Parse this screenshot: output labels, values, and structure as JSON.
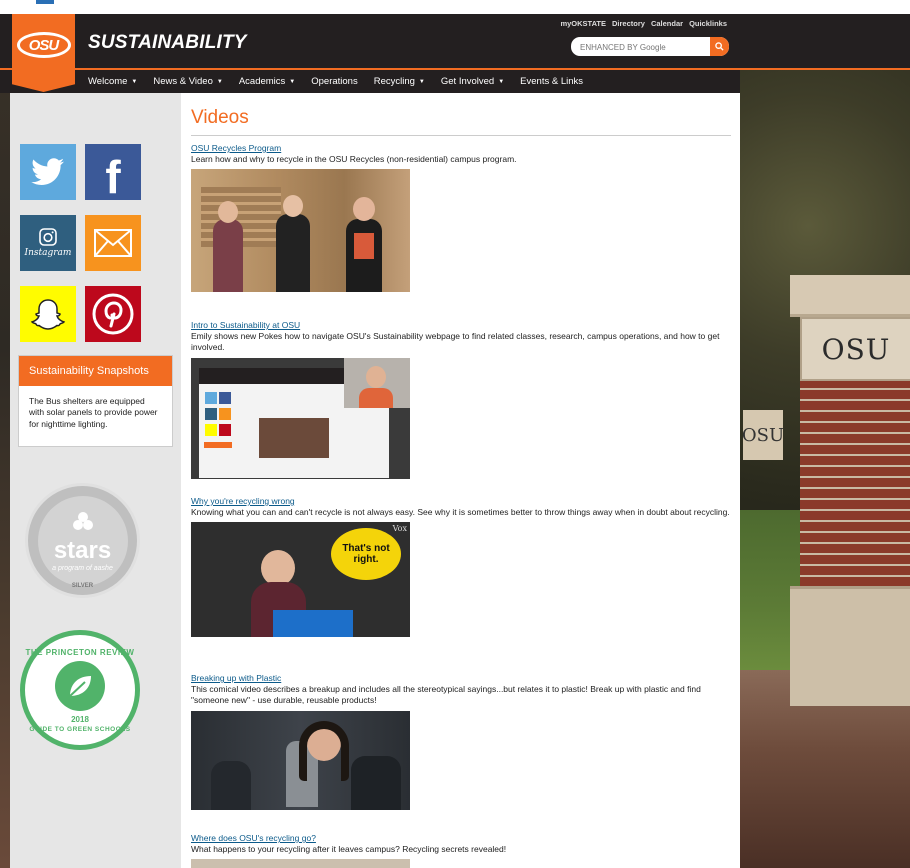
{
  "header": {
    "site_title": "SUSTAINABILITY",
    "logo_text": "OSU",
    "quicklinks": [
      "myOKSTATE",
      "Directory",
      "Calendar",
      "Quicklinks"
    ],
    "search_placeholder": "ENHANCED BY Google"
  },
  "nav": {
    "items": [
      {
        "label": "Welcome",
        "dropdown": true
      },
      {
        "label": "News & Video",
        "dropdown": true
      },
      {
        "label": "Academics",
        "dropdown": true
      },
      {
        "label": "Operations",
        "dropdown": false
      },
      {
        "label": "Recycling",
        "dropdown": true
      },
      {
        "label": "Get Involved",
        "dropdown": true
      },
      {
        "label": "Events & Links",
        "dropdown": false
      }
    ]
  },
  "sidebar": {
    "social": [
      {
        "icon": "twitter-icon",
        "color": "#5ea9dd"
      },
      {
        "icon": "facebook-icon",
        "color": "#3b5998"
      },
      {
        "icon": "instagram-icon",
        "color": "#2f5f7f",
        "text": "Instagram"
      },
      {
        "icon": "email-icon",
        "color": "#f7931e"
      },
      {
        "icon": "snapchat-icon",
        "color": "#fffc00"
      },
      {
        "icon": "pinterest-icon",
        "color": "#bd081c"
      }
    ],
    "snapshot": {
      "title": "Sustainability Snapshots",
      "body": "The Bus shelters are equipped with solar panels to provide power for nighttime lighting."
    },
    "stars": {
      "word": "stars",
      "sub": "a program of aashe",
      "level": "SILVER"
    },
    "princeton": {
      "top": "THE PRINCETON REVIEW",
      "year": "2018",
      "bottom": "GUIDE TO GREEN SCHOOLS"
    }
  },
  "main": {
    "title": "Videos",
    "videos": [
      {
        "title": "OSU Recycles Program",
        "desc": "Learn how and why to recycle in the OSU Recycles (non-residential) campus program."
      },
      {
        "title": "Intro to Sustainability at OSU",
        "desc": "Emily shows new Pokes how to navigate OSU's Sustainability webpage to find related classes, research, campus operations, and how to get involved."
      },
      {
        "title": "Why you're recycling wrong",
        "desc": "Knowing what you can and can't recycle is not always easy. See why it is sometimes better to throw things away when in doubt about recycling.",
        "overlay_text": "That's not right.",
        "overlay_brand": "Vox"
      },
      {
        "title": "Breaking up with Plastic",
        "desc": "This comical video describes a breakup and includes all the stereotypical sayings...but relates it to plastic! Break up with plastic and find \"someone new\" - use durable, reusable products!"
      },
      {
        "title": "Where does OSU's recycling go?",
        "desc": "What happens to your recycling after it leaves campus? Recycling secrets revealed!"
      }
    ]
  },
  "background": {
    "pillar_text": "OSU"
  },
  "colors": {
    "brand_orange": "#f26c22",
    "header_dark": "#231f20",
    "link": "#0b5a8a"
  }
}
